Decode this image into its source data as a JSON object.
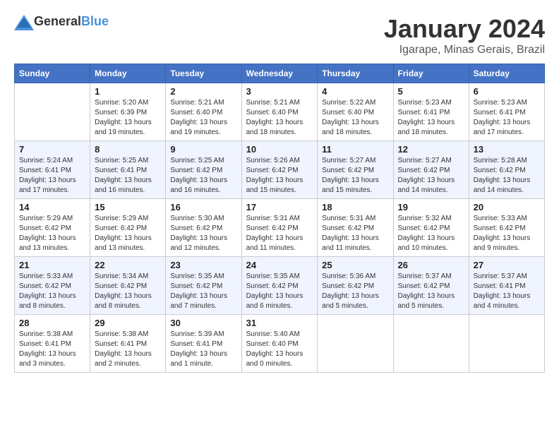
{
  "logo": {
    "general": "General",
    "blue": "Blue"
  },
  "title": "January 2024",
  "location": "Igarape, Minas Gerais, Brazil",
  "days_of_week": [
    "Sunday",
    "Monday",
    "Tuesday",
    "Wednesday",
    "Thursday",
    "Friday",
    "Saturday"
  ],
  "weeks": [
    [
      {
        "day": "",
        "sunrise": "",
        "sunset": "",
        "daylight": ""
      },
      {
        "day": "1",
        "sunrise": "Sunrise: 5:20 AM",
        "sunset": "Sunset: 6:39 PM",
        "daylight": "Daylight: 13 hours and 19 minutes."
      },
      {
        "day": "2",
        "sunrise": "Sunrise: 5:21 AM",
        "sunset": "Sunset: 6:40 PM",
        "daylight": "Daylight: 13 hours and 19 minutes."
      },
      {
        "day": "3",
        "sunrise": "Sunrise: 5:21 AM",
        "sunset": "Sunset: 6:40 PM",
        "daylight": "Daylight: 13 hours and 18 minutes."
      },
      {
        "day": "4",
        "sunrise": "Sunrise: 5:22 AM",
        "sunset": "Sunset: 6:40 PM",
        "daylight": "Daylight: 13 hours and 18 minutes."
      },
      {
        "day": "5",
        "sunrise": "Sunrise: 5:23 AM",
        "sunset": "Sunset: 6:41 PM",
        "daylight": "Daylight: 13 hours and 18 minutes."
      },
      {
        "day": "6",
        "sunrise": "Sunrise: 5:23 AM",
        "sunset": "Sunset: 6:41 PM",
        "daylight": "Daylight: 13 hours and 17 minutes."
      }
    ],
    [
      {
        "day": "7",
        "sunrise": "Sunrise: 5:24 AM",
        "sunset": "Sunset: 6:41 PM",
        "daylight": "Daylight: 13 hours and 17 minutes."
      },
      {
        "day": "8",
        "sunrise": "Sunrise: 5:25 AM",
        "sunset": "Sunset: 6:41 PM",
        "daylight": "Daylight: 13 hours and 16 minutes."
      },
      {
        "day": "9",
        "sunrise": "Sunrise: 5:25 AM",
        "sunset": "Sunset: 6:42 PM",
        "daylight": "Daylight: 13 hours and 16 minutes."
      },
      {
        "day": "10",
        "sunrise": "Sunrise: 5:26 AM",
        "sunset": "Sunset: 6:42 PM",
        "daylight": "Daylight: 13 hours and 15 minutes."
      },
      {
        "day": "11",
        "sunrise": "Sunrise: 5:27 AM",
        "sunset": "Sunset: 6:42 PM",
        "daylight": "Daylight: 13 hours and 15 minutes."
      },
      {
        "day": "12",
        "sunrise": "Sunrise: 5:27 AM",
        "sunset": "Sunset: 6:42 PM",
        "daylight": "Daylight: 13 hours and 14 minutes."
      },
      {
        "day": "13",
        "sunrise": "Sunrise: 5:28 AM",
        "sunset": "Sunset: 6:42 PM",
        "daylight": "Daylight: 13 hours and 14 minutes."
      }
    ],
    [
      {
        "day": "14",
        "sunrise": "Sunrise: 5:29 AM",
        "sunset": "Sunset: 6:42 PM",
        "daylight": "Daylight: 13 hours and 13 minutes."
      },
      {
        "day": "15",
        "sunrise": "Sunrise: 5:29 AM",
        "sunset": "Sunset: 6:42 PM",
        "daylight": "Daylight: 13 hours and 13 minutes."
      },
      {
        "day": "16",
        "sunrise": "Sunrise: 5:30 AM",
        "sunset": "Sunset: 6:42 PM",
        "daylight": "Daylight: 13 hours and 12 minutes."
      },
      {
        "day": "17",
        "sunrise": "Sunrise: 5:31 AM",
        "sunset": "Sunset: 6:42 PM",
        "daylight": "Daylight: 13 hours and 11 minutes."
      },
      {
        "day": "18",
        "sunrise": "Sunrise: 5:31 AM",
        "sunset": "Sunset: 6:42 PM",
        "daylight": "Daylight: 13 hours and 11 minutes."
      },
      {
        "day": "19",
        "sunrise": "Sunrise: 5:32 AM",
        "sunset": "Sunset: 6:42 PM",
        "daylight": "Daylight: 13 hours and 10 minutes."
      },
      {
        "day": "20",
        "sunrise": "Sunrise: 5:33 AM",
        "sunset": "Sunset: 6:42 PM",
        "daylight": "Daylight: 13 hours and 9 minutes."
      }
    ],
    [
      {
        "day": "21",
        "sunrise": "Sunrise: 5:33 AM",
        "sunset": "Sunset: 6:42 PM",
        "daylight": "Daylight: 13 hours and 8 minutes."
      },
      {
        "day": "22",
        "sunrise": "Sunrise: 5:34 AM",
        "sunset": "Sunset: 6:42 PM",
        "daylight": "Daylight: 13 hours and 8 minutes."
      },
      {
        "day": "23",
        "sunrise": "Sunrise: 5:35 AM",
        "sunset": "Sunset: 6:42 PM",
        "daylight": "Daylight: 13 hours and 7 minutes."
      },
      {
        "day": "24",
        "sunrise": "Sunrise: 5:35 AM",
        "sunset": "Sunset: 6:42 PM",
        "daylight": "Daylight: 13 hours and 6 minutes."
      },
      {
        "day": "25",
        "sunrise": "Sunrise: 5:36 AM",
        "sunset": "Sunset: 6:42 PM",
        "daylight": "Daylight: 13 hours and 5 minutes."
      },
      {
        "day": "26",
        "sunrise": "Sunrise: 5:37 AM",
        "sunset": "Sunset: 6:42 PM",
        "daylight": "Daylight: 13 hours and 5 minutes."
      },
      {
        "day": "27",
        "sunrise": "Sunrise: 5:37 AM",
        "sunset": "Sunset: 6:41 PM",
        "daylight": "Daylight: 13 hours and 4 minutes."
      }
    ],
    [
      {
        "day": "28",
        "sunrise": "Sunrise: 5:38 AM",
        "sunset": "Sunset: 6:41 PM",
        "daylight": "Daylight: 13 hours and 3 minutes."
      },
      {
        "day": "29",
        "sunrise": "Sunrise: 5:38 AM",
        "sunset": "Sunset: 6:41 PM",
        "daylight": "Daylight: 13 hours and 2 minutes."
      },
      {
        "day": "30",
        "sunrise": "Sunrise: 5:39 AM",
        "sunset": "Sunset: 6:41 PM",
        "daylight": "Daylight: 13 hours and 1 minute."
      },
      {
        "day": "31",
        "sunrise": "Sunrise: 5:40 AM",
        "sunset": "Sunset: 6:40 PM",
        "daylight": "Daylight: 13 hours and 0 minutes."
      },
      {
        "day": "",
        "sunrise": "",
        "sunset": "",
        "daylight": ""
      },
      {
        "day": "",
        "sunrise": "",
        "sunset": "",
        "daylight": ""
      },
      {
        "day": "",
        "sunrise": "",
        "sunset": "",
        "daylight": ""
      }
    ]
  ]
}
